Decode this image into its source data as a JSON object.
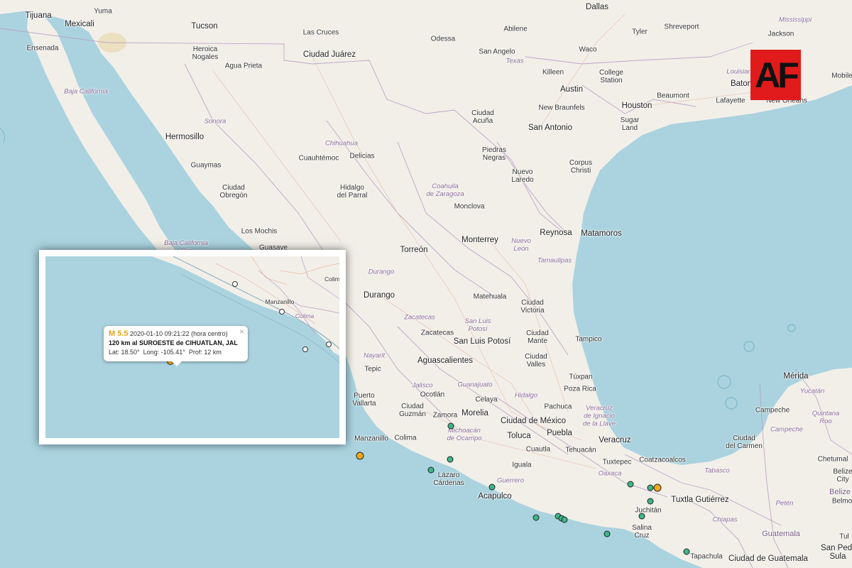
{
  "logo": {
    "text": "AF"
  },
  "colors": {
    "water": "#aad3df",
    "land": "#f2efe9",
    "quake_recent": "#3fb58a",
    "quake_main": "#f0a818",
    "logo_bg": "#e11b1b"
  },
  "map_labels": {
    "tijuana": "Tijuana",
    "yuma": "Yuma",
    "mexicali": "Mexicali",
    "ensenada": "Ensenada",
    "tucson": "Tucson",
    "heroica_nogales": "Heroica\nNogales",
    "agua_prieta": "Agua Prieta",
    "las_cruces": "Las Cruces",
    "ciudad_juarez": "Ciudad Juárez",
    "odessa": "Odessa",
    "abilene": "Abilene",
    "dallas": "Dallas",
    "tyler": "Tyler",
    "shreveport": "Shreveport",
    "jackson": "Jackson",
    "mississippi": "Mississippi",
    "san_angelo": "San Angelo",
    "texas": "Texas",
    "waco": "Waco",
    "killeen": "Killeen",
    "college_station": "College\nStation",
    "austin": "Austin",
    "beaumont": "Beaumont",
    "lafayette": "Lafayette",
    "baton": "Baton",
    "new_orleans": "New Orleans",
    "louisiana": "Louisian",
    "mobile": "Mobile",
    "new_braunfels": "New Braunfels",
    "houston": "Houston",
    "sugar_land": "Sugar\nLand",
    "san_antonio": "San Antonio",
    "baja_california": "Baja California",
    "sonora": "Sonora",
    "hermosillo": "Hermosillo",
    "chihuahua": "Chihuahua",
    "cuauhtemoc": "Cuauhtémoc",
    "delicias": "Delicias",
    "guaymas": "Guaymas",
    "ciudad_obregon": "Ciudad\nObregón",
    "hidalgo_del_parral": "Hidalgo\ndel Parral",
    "ciudad_acuna": "Ciudad\nAcuña",
    "piedras_negras": "Piedras\nNegras",
    "corpus_christi": "Corpus\nChristi",
    "nuevo_laredo": "Nuevo\nLaredo",
    "coahuila": "Coahuila\nde Zaragoza",
    "monclova": "Monclova",
    "los_mochis": "Los Mochis",
    "guasave": "Guasave",
    "baja_california_sur": "Baja California\nSur",
    "torreon": "Torreón",
    "monterrey": "Monterrey",
    "nuevo_leon": "Nuevo\nLeón",
    "reynosa": "Reynosa",
    "matamoros": "Matamoros",
    "durango_state": "Durango",
    "durango": "Durango",
    "tamaulipas": "Tamaulipas",
    "matehuala": "Matehuala",
    "ciudad_victoria": "Ciudad\nVictoria",
    "zacatecas_state": "Zacatecas",
    "zacatecas": "Zacatecas",
    "san_luis_potosi_state": "San Luis\nPotosí",
    "ciudad_mante": "Ciudad\nMante",
    "tampico": "Tampico",
    "san_luis_potosi": "San Luis Potosí",
    "aguascalientes": "Aguascalientes",
    "ciudad_valles": "Ciudad\nValles",
    "nayarit": "Nayarit",
    "tepic": "Tepic",
    "tuxpan": "Túxpan",
    "poza_rica": "Poza Rica",
    "merida": "Mérida",
    "yucatan": "Yucatán",
    "jalisco": "Jalisco",
    "guanajuato": "Guanajuato",
    "hidalgo": "Hidalgo",
    "puerto_vallarta": "Puerto\nVallarta",
    "ocotlan": "Ocotlán",
    "celaya": "Celaya",
    "pachuca": "Pachuca",
    "campeche_city": "Campeche",
    "quintana_roo": "Quintana\nRoo",
    "veracruz_state": "Veracruz\nde Ignacio\nde la Llave",
    "ciudad_guzman": "Ciudad\nGuzmán",
    "zamora": "Zamora",
    "morelia": "Morelia",
    "ciudad_de_mexico": "Ciudad de México",
    "campeche_state": "Campeche",
    "michoacan": "Michoacán\nde Ocampo",
    "toluca": "Toluca",
    "puebla": "Puebla",
    "veracruz": "Veracruz",
    "manzanillo": "Manzanillo",
    "colima": "Colima",
    "cuautla": "Cuautla",
    "tehuacan": "Tehuacán",
    "ciudad_del_carmen": "Ciudad\ndel Carmen",
    "chetumal": "Chetumal",
    "coatzacoalcos": "Coatzacoalcos",
    "belize_city": "Belize\nCity",
    "lazaro_cardenas": "Lázaro\nCárdenas",
    "guerrero": "Guerrero",
    "iguala": "Iguala",
    "tuxtepec": "Tuxtepec",
    "tabasco": "Tabasco",
    "belize": "Belize",
    "oaxaca": "Oaxaca",
    "acapulco": "Acapulco",
    "juchitan": "Juchitán",
    "tuxtla_gutierrez": "Tuxtla Gutiérrez",
    "peten": "Petén",
    "belmopan": "Belmo",
    "chiapas": "Chiapas",
    "salina_cruz": "Salina\nCruz",
    "guatemala": "Guatemala",
    "tapachula": "Tapachula",
    "ciudad_de_guatemala": "Ciudad de Guatemala",
    "san_pedro_sula": "San Pedr\nSula",
    "tula_partial": "Tul"
  },
  "inset": {
    "labels": {
      "manzanillo": "Manzanillo",
      "colima_state": "Colima",
      "colim": "Colim"
    },
    "popup": {
      "magnitude": "M 5.5",
      "datetime": "2020-01-10  09:21:22 (hora centro)",
      "location": "120 km al SUROESTE de CIHUATLAN, JAL",
      "lat_label": "Lat:",
      "lat": "18.50°",
      "long_label": "Long:",
      "long": "-105.41°",
      "depth_label": "Prof:",
      "depth": "12 km",
      "close": "×"
    }
  }
}
